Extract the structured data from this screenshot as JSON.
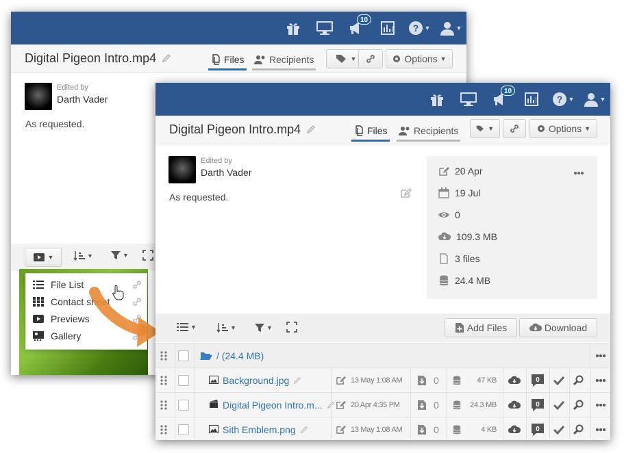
{
  "topbar": {
    "notification_count": "10"
  },
  "document": {
    "title": "Digital Pigeon Intro.mp4",
    "tabs": {
      "files": "Files",
      "recipients": "Recipients"
    },
    "options_label": "Options"
  },
  "post": {
    "edited_by_label": "Edited by",
    "author": "Darth Vader",
    "message": "As requested."
  },
  "view_menu": {
    "items": [
      "File List",
      "Contact sheet",
      "Previews",
      "Gallery"
    ]
  },
  "info": {
    "modified": "20 Apr",
    "expires": "19 Jul",
    "views": "0",
    "downloaded": "109.3 MB",
    "file_count": "3 files",
    "size": "24.4 MB"
  },
  "actions": {
    "add_files": "Add Files",
    "download": "Download"
  },
  "folder": {
    "label": "/ (24.4 MB)"
  },
  "files": [
    {
      "name": "Background.jpg",
      "date": "13 May 1:08 AM",
      "downloads": "0",
      "size": "47 KB",
      "comments": "0"
    },
    {
      "name": "Digital Pigeon Intro.m...",
      "date": "20 Apr 4:35 PM",
      "downloads": "0",
      "size": "24.3 MB",
      "comments": "0"
    },
    {
      "name": "Sith Emblem.png",
      "date": "13 May 1:08 AM",
      "downloads": "0",
      "size": "4 KB",
      "comments": "0"
    }
  ],
  "colors": {
    "topbar": "#2e578f",
    "link": "#2e73b5",
    "arrow": "#e88a35"
  }
}
